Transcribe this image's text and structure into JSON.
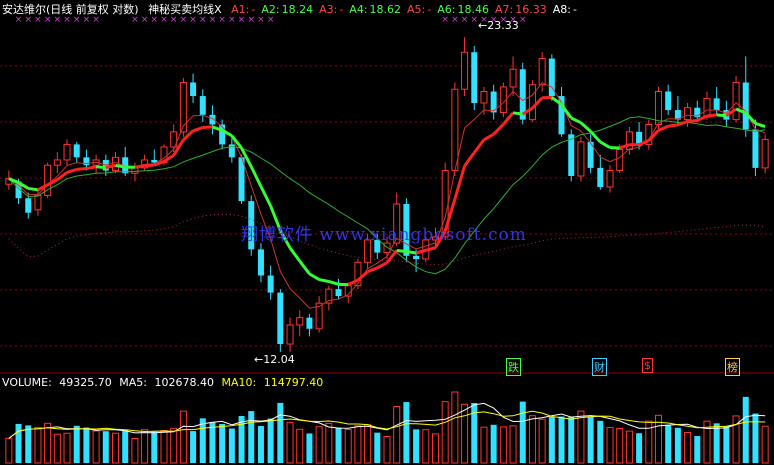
{
  "header": {
    "title": "安达维尔(日线 前复权 对数)",
    "indicator": "神秘买卖均线X",
    "fields": [
      {
        "label": "A1:",
        "value": "-",
        "label_color": "#ff4444",
        "value_color": "#ff4444"
      },
      {
        "label": "A2:",
        "value": "18.24",
        "label_color": "#44ff44",
        "value_color": "#44ff44"
      },
      {
        "label": "A3:",
        "value": "-",
        "label_color": "#ff4444",
        "value_color": "#ff4444"
      },
      {
        "label": "A4:",
        "value": "18.62",
        "label_color": "#44ff44",
        "value_color": "#44ff44"
      },
      {
        "label": "A5:",
        "value": "-",
        "label_color": "#ff4444",
        "value_color": "#ff4444"
      },
      {
        "label": "A6:",
        "value": "18.46",
        "label_color": "#44ff44",
        "value_color": "#44ff44"
      },
      {
        "label": "A7:",
        "value": "16.33",
        "label_color": "#ff4444",
        "value_color": "#ff4444"
      },
      {
        "label": "A8:",
        "value": "-",
        "label_color": "#ffffff",
        "value_color": "#ffffff"
      }
    ]
  },
  "volume_header": {
    "vol_label": "VOLUME:",
    "vol_value": "49325.70",
    "ma5_label": "MA5:",
    "ma5_value": "102678.40",
    "ma10_label": "MA10:",
    "ma10_value": "114797.40"
  },
  "annotations": {
    "high": "23.33",
    "low": "12.04"
  },
  "watermark": "翔博软件 www.xiangbosoft.com",
  "events": [
    {
      "label": "跌",
      "color": "#44ff44"
    },
    {
      "label": "财",
      "color": "#44ccff"
    },
    {
      "label": "$",
      "color": "#ff3333"
    },
    {
      "label": "榜",
      "color": "#ffcc44"
    }
  ],
  "colors": {
    "up": "#ff3333",
    "down": "#33e0ff",
    "ma_green": "#33ff33",
    "ma_red": "#ff2222",
    "grid": "#8b0000",
    "ma5": "#ffffff",
    "ma10": "#ffff00"
  },
  "chart_data": {
    "type": "candlestick",
    "scale": "log",
    "ylim": [
      11.5,
      24.5
    ],
    "high_marker": 23.33,
    "low_marker": 12.04,
    "candles": [
      [
        17.1,
        17.6,
        16.9,
        17.3
      ],
      [
        17.2,
        17.3,
        16.4,
        16.6
      ],
      [
        16.6,
        16.8,
        15.9,
        16.1
      ],
      [
        16.2,
        16.9,
        16.0,
        16.7
      ],
      [
        16.7,
        17.9,
        16.6,
        17.8
      ],
      [
        17.8,
        18.3,
        17.5,
        18.0
      ],
      [
        18.0,
        18.8,
        17.8,
        18.6
      ],
      [
        18.6,
        18.7,
        17.9,
        18.1
      ],
      [
        18.1,
        18.4,
        17.6,
        17.8
      ],
      [
        17.8,
        18.2,
        17.5,
        18.0
      ],
      [
        18.0,
        18.2,
        17.4,
        17.6
      ],
      [
        17.6,
        18.3,
        17.5,
        18.1
      ],
      [
        18.1,
        18.5,
        17.4,
        17.5
      ],
      [
        17.5,
        17.9,
        17.2,
        17.7
      ],
      [
        17.7,
        18.2,
        17.6,
        18.0
      ],
      [
        18.0,
        18.4,
        17.8,
        17.9
      ],
      [
        17.9,
        18.6,
        17.8,
        18.5
      ],
      [
        18.5,
        19.4,
        18.3,
        19.1
      ],
      [
        19.1,
        21.4,
        18.9,
        21.2
      ],
      [
        21.2,
        21.6,
        20.3,
        20.6
      ],
      [
        20.6,
        20.9,
        19.5,
        19.8
      ],
      [
        19.8,
        20.2,
        19.0,
        19.4
      ],
      [
        19.4,
        19.6,
        18.4,
        18.6
      ],
      [
        18.6,
        18.9,
        17.9,
        18.1
      ],
      [
        18.1,
        18.2,
        16.4,
        16.5
      ],
      [
        16.5,
        16.7,
        14.7,
        14.9
      ],
      [
        14.9,
        15.1,
        13.9,
        14.1
      ],
      [
        14.1,
        14.4,
        13.4,
        13.6
      ],
      [
        13.6,
        13.7,
        12.0,
        12.2
      ],
      [
        12.2,
        12.9,
        12.0,
        12.7
      ],
      [
        12.7,
        13.1,
        12.4,
        12.9
      ],
      [
        12.9,
        13.0,
        12.4,
        12.6
      ],
      [
        12.6,
        13.5,
        12.5,
        13.3
      ],
      [
        13.3,
        13.8,
        13.1,
        13.7
      ],
      [
        13.7,
        14.0,
        13.4,
        13.5
      ],
      [
        13.5,
        13.9,
        13.3,
        13.8
      ],
      [
        13.8,
        14.6,
        13.7,
        14.5
      ],
      [
        14.5,
        15.4,
        14.3,
        15.2
      ],
      [
        15.2,
        15.4,
        14.6,
        14.8
      ],
      [
        14.8,
        15.3,
        14.6,
        15.1
      ],
      [
        15.1,
        16.8,
        15.0,
        16.4
      ],
      [
        16.4,
        16.6,
        14.5,
        14.7
      ],
      [
        14.7,
        14.9,
        14.2,
        14.6
      ],
      [
        14.6,
        15.3,
        14.5,
        15.2
      ],
      [
        15.2,
        15.6,
        14.9,
        15.3
      ],
      [
        15.3,
        17.9,
        15.2,
        17.6
      ],
      [
        17.6,
        21.2,
        17.4,
        20.9
      ],
      [
        20.9,
        23.33,
        20.6,
        22.6
      ],
      [
        22.6,
        22.9,
        20.0,
        20.3
      ],
      [
        20.3,
        21.0,
        19.8,
        20.8
      ],
      [
        20.8,
        21.1,
        19.6,
        19.9
      ],
      [
        19.9,
        21.2,
        19.7,
        21.0
      ],
      [
        21.0,
        22.4,
        20.6,
        21.8
      ],
      [
        21.8,
        22.1,
        19.4,
        19.6
      ],
      [
        19.6,
        21.3,
        19.5,
        21.1
      ],
      [
        21.1,
        22.6,
        20.8,
        22.3
      ],
      [
        22.3,
        22.5,
        20.4,
        20.6
      ],
      [
        20.6,
        21.0,
        18.9,
        19.0
      ],
      [
        19.0,
        19.2,
        17.2,
        17.4
      ],
      [
        17.4,
        18.9,
        17.2,
        18.7
      ],
      [
        18.7,
        19.0,
        17.5,
        17.7
      ],
      [
        17.7,
        18.2,
        16.9,
        17.0
      ],
      [
        17.0,
        17.8,
        16.8,
        17.6
      ],
      [
        17.6,
        18.6,
        17.5,
        18.4
      ],
      [
        18.4,
        19.3,
        18.2,
        19.1
      ],
      [
        19.1,
        19.5,
        18.4,
        18.6
      ],
      [
        18.6,
        19.6,
        18.4,
        19.4
      ],
      [
        19.4,
        21.0,
        19.2,
        20.8
      ],
      [
        20.8,
        21.1,
        19.8,
        20.0
      ],
      [
        20.0,
        20.6,
        19.4,
        19.6
      ],
      [
        19.6,
        20.3,
        19.3,
        20.1
      ],
      [
        20.1,
        20.4,
        19.5,
        19.7
      ],
      [
        19.7,
        20.8,
        19.6,
        20.5
      ],
      [
        20.5,
        21.0,
        19.8,
        20.0
      ],
      [
        20.0,
        20.4,
        19.3,
        19.6
      ],
      [
        19.6,
        21.5,
        19.5,
        21.2
      ],
      [
        21.2,
        22.4,
        18.9,
        19.2
      ],
      [
        19.2,
        19.6,
        17.4,
        17.7
      ],
      [
        17.7,
        19.0,
        17.5,
        18.8
      ]
    ],
    "volume_ylim": [
      0,
      220000
    ]
  }
}
